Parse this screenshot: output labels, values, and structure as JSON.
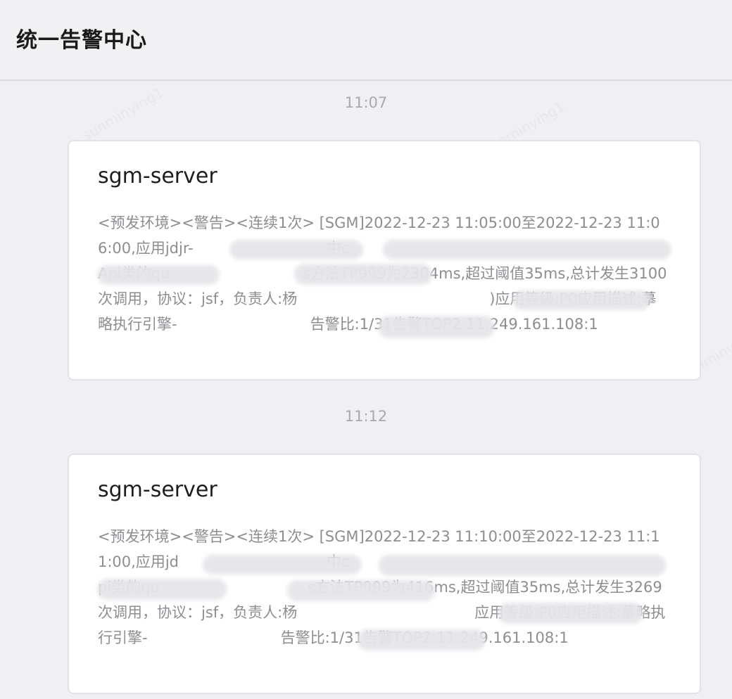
{
  "header": {
    "title": "统一告警中心"
  },
  "watermark": "sunminying1",
  "messages": [
    {
      "time": "11:07",
      "title": "sgm-server",
      "body": "<预发环境><警告><连续1次> [SGM]2022-12-23 11:05:00至2022-12-23 11:06:00,应用jdjr-　　　　　　　　　中c　　　　　　　　　　　　　　　　　　　　　　Api类的qu　　　　　　　　　s方法TP999为2304ms,超过阈值35ms,总计发生3100次调用，协议：jsf，负责人:杨　　　　　　　　　　　　　)应用等级:P0应用描述:摹略执行引擎-　　　　　　　　　告警比:1/31告警TOP2:11.249.161.108:1"
    },
    {
      "time": "11:12",
      "title": "sgm-server",
      "body": "<预发环境><警告><连续1次> [SGM]2022-12-23 11:10:00至2022-12-23 11:11:00,应用jd　　　　　　　　　　中c　　　　　　　　　　　　　　　　　　　　　　　pi类的qu　　　　　　　　　　s方法TP999为416ms,超过阈值35ms,总计发生3269次调用，协议：jsf，负责人:杨　　　　　　　　　　　　应用等级:P0应用描述:摹略执行引擎-　　　　　　　　　告警比:1/31告警TOP2:11.249.161.108:1"
    }
  ]
}
